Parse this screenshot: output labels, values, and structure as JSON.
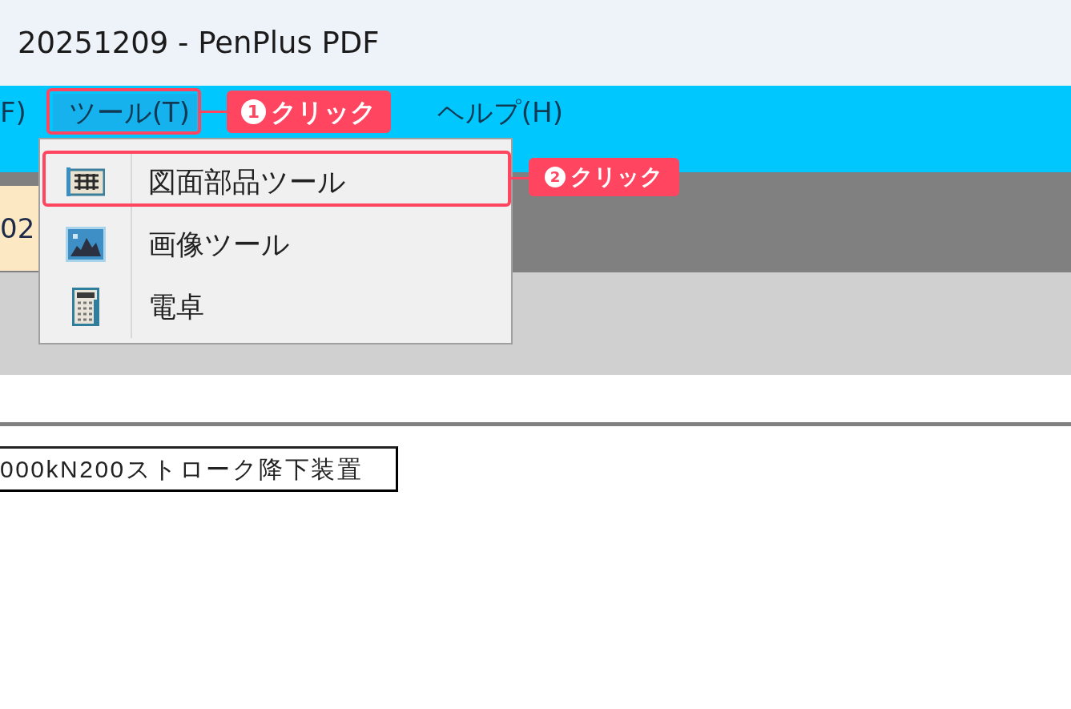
{
  "window": {
    "title": "20251209 - PenPlus PDF"
  },
  "menu_bar": {
    "items": [
      {
        "label": "F)",
        "selected": false
      },
      {
        "label": "ツール(T)",
        "selected": true,
        "callout": {
          "step": "1",
          "label": "クリック"
        }
      },
      {
        "label": "ヘルプ(H)",
        "selected": false
      }
    ]
  },
  "tab": {
    "label": "02"
  },
  "dropdown": {
    "items": [
      {
        "kind": "drawing-parts",
        "label": "図面部品ツール",
        "callout": {
          "step": "2",
          "label": "クリック"
        }
      },
      {
        "kind": "image",
        "label": "画像ツール"
      },
      {
        "kind": "calculator",
        "label": "電卓"
      }
    ]
  },
  "document": {
    "label_box": "000kN200ストローク降下装置"
  }
}
